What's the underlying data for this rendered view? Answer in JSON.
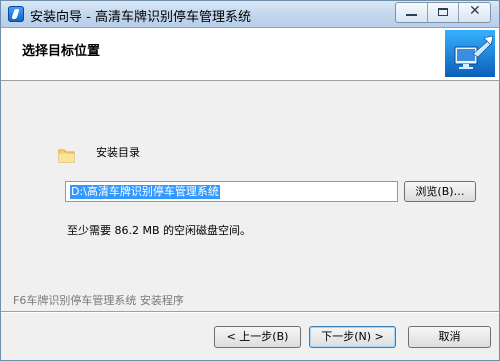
{
  "window": {
    "title": "安装向导 - 高清车牌识别停车管理系统"
  },
  "header": {
    "title": "选择目标位置"
  },
  "install_dir": {
    "label": "安装目录",
    "path_value": "D:\\高清车牌识别停车管理系统",
    "browse_label": "浏览(B)…"
  },
  "space_required": "至少需要 86.2 MB 的空闲磁盘空间。",
  "branding": "F6车牌识别停车管理系统 安装程序",
  "footer": {
    "back_label": "< 上一步(B)",
    "next_label": "下一步(N) >",
    "cancel_label": "取消"
  },
  "icons": {
    "app": "setup-icon",
    "folder": "folder-icon",
    "logo": "computer-install-icon"
  },
  "colors": {
    "selection": "#3399ff",
    "header_bg": "#ffffff",
    "body_bg": "#f0f0f0"
  }
}
